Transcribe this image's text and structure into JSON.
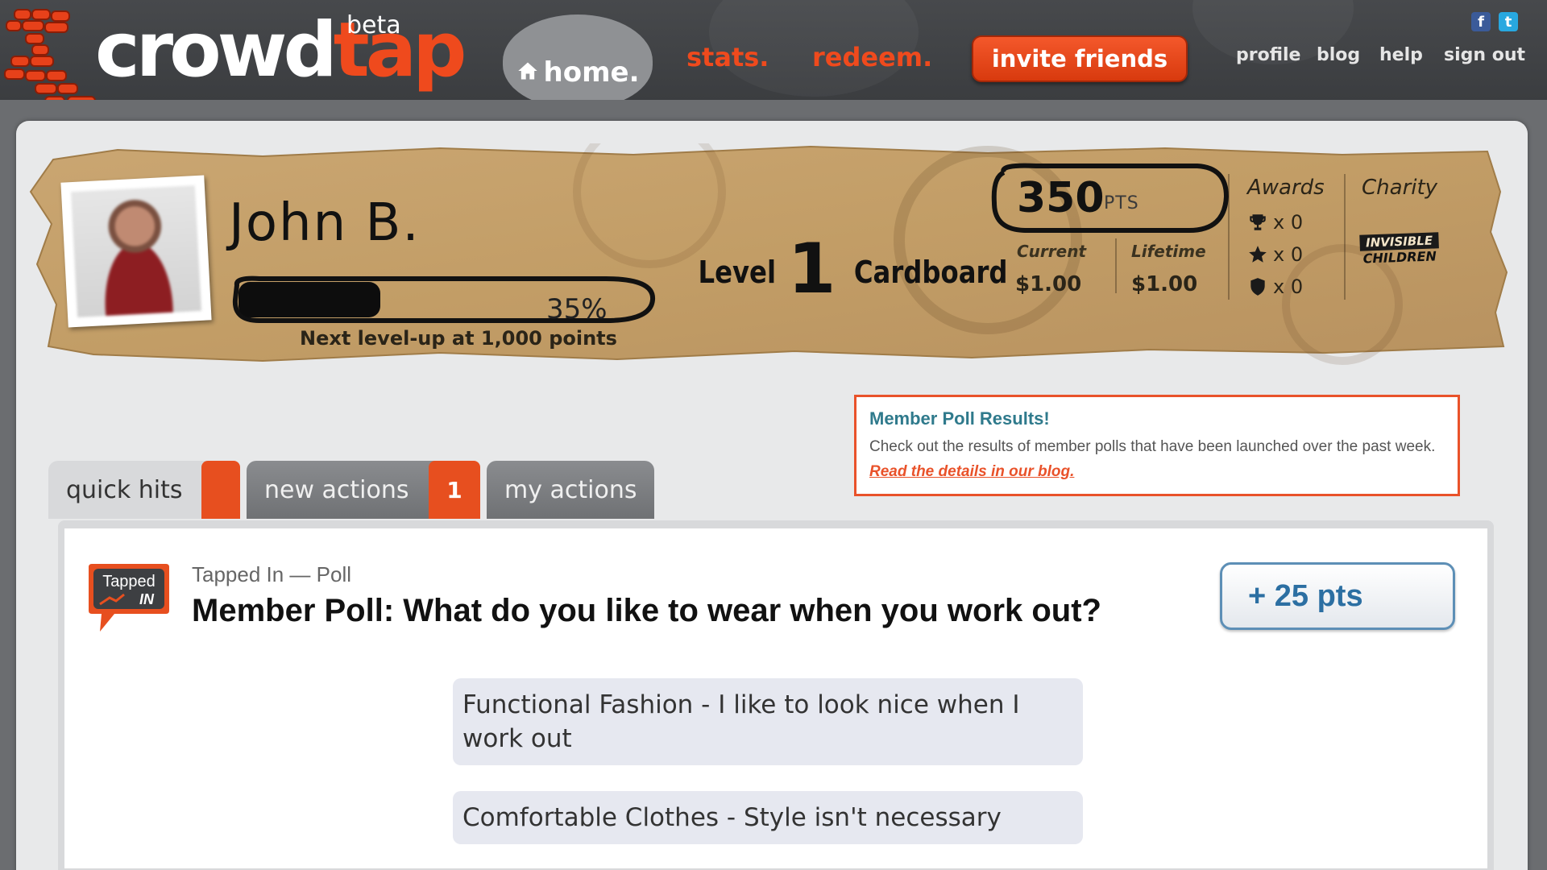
{
  "header": {
    "logo_part1": "crowd",
    "logo_part2": "tap",
    "logo_badge": "beta",
    "nav": {
      "home": "home.",
      "stats": "stats.",
      "redeem": "redeem."
    },
    "invite_button": "invite friends",
    "utility_links": [
      "profile",
      "blog",
      "help",
      "sign out"
    ],
    "social": {
      "facebook": "f",
      "twitter": "t"
    },
    "colors": {
      "brand": "#ef4a1d",
      "bar": "#3f4144"
    }
  },
  "profile": {
    "name": "John B.",
    "progress_percent": "35%",
    "progress_fraction": 0.35,
    "next_level_text": "Next level-up at 1,000 points",
    "level_word": "Level",
    "level_number": "1",
    "level_name": "Cardboard",
    "points_value": "350",
    "points_unit": "PTS",
    "current_label": "Current",
    "current_value": "$1.00",
    "lifetime_label": "Lifetime",
    "lifetime_value": "$1.00",
    "awards_label": "Awards",
    "awards": [
      {
        "icon": "trophy-icon",
        "count": "x 0"
      },
      {
        "icon": "star-icon",
        "count": "x 0"
      },
      {
        "icon": "shield-icon",
        "count": "x 0"
      }
    ],
    "charity_label": "Charity",
    "charity_logo_text": [
      "INVISIBLE",
      "CHILDREN"
    ]
  },
  "notice": {
    "title": "Member Poll Results!",
    "body": "Check out the results of member polls that have been launched over the past week.",
    "link": "Read the details in our blog."
  },
  "tabs": [
    {
      "label": "quick hits",
      "badge": ""
    },
    {
      "label": "new actions",
      "badge": "1"
    },
    {
      "label": "my actions",
      "badge": ""
    }
  ],
  "action": {
    "icon_text": [
      "Tapped",
      "IN"
    ],
    "category": "Tapped In — Poll",
    "question": "Member Poll: What do you like to wear when you work out?",
    "points_button": "+ 25 pts",
    "options": [
      "Functional Fashion - I like to look nice when I work out",
      "Comfortable Clothes - Style isn't necessary"
    ]
  }
}
